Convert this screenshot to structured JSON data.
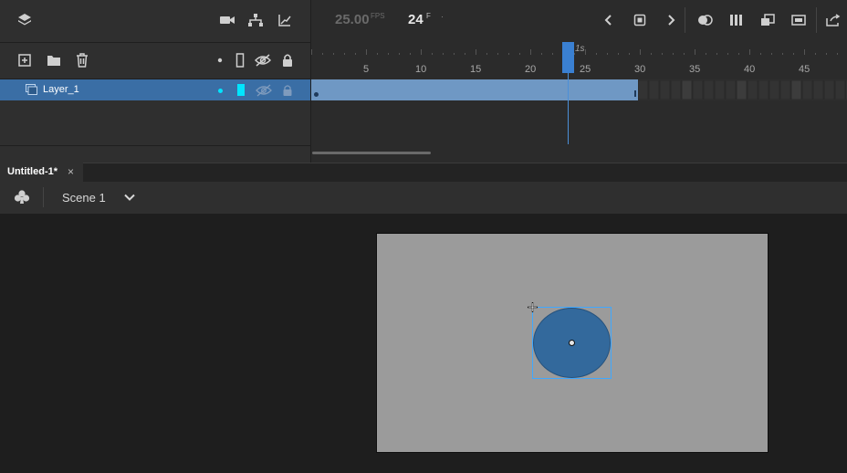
{
  "timeline": {
    "fps_value": "25.00",
    "fps_unit": "FPS",
    "current_frame": "24",
    "frame_unit": "F",
    "second_marker": "1s",
    "ruler_ticks": [
      "5",
      "10",
      "15",
      "20",
      "25",
      "30",
      "35",
      "40",
      "45"
    ],
    "header_icons": [
      "layers-icon",
      "camera-icon",
      "hierarchy-icon",
      "graph-icon"
    ],
    "playback_icons": [
      "prev-frame-icon",
      "stop-icon",
      "next-frame-icon",
      "onion-skin-icon",
      "edit-multiple-frames-icon",
      "insert-keyframe-icon",
      "insert-tween-icon",
      "export-icon"
    ],
    "layer_toolbar_icons": [
      "new-layer-icon",
      "new-folder-icon",
      "delete-icon",
      "highlight-dot-icon",
      "outline-icon",
      "visibility-icon",
      "lock-icon"
    ],
    "layers": [
      {
        "name": "Layer_1",
        "color": "#00e5ff",
        "selected": true
      }
    ],
    "playhead_frame": 24,
    "span_end_frame": 30
  },
  "document": {
    "tab_title": "Untitled-1*",
    "close_glyph": "×"
  },
  "scene": {
    "icon": "symbol-clubs-icon",
    "label": "Scene 1"
  },
  "colors": {
    "accent": "#3a6ea5",
    "selection": "#3fa8ff",
    "shape_fill": "#33699c",
    "stage": "#9b9b9b",
    "layer_color": "#00e5ff"
  }
}
